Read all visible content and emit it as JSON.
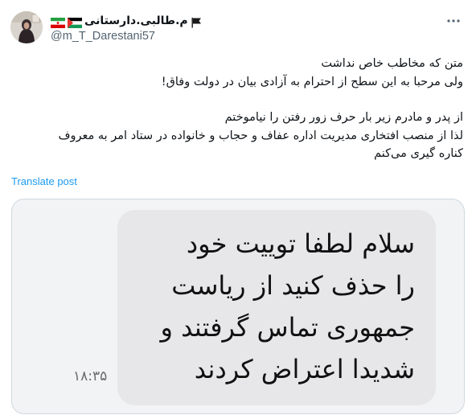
{
  "author": {
    "display_name": "م.طالبی.دارستانی",
    "handle": "@m_T_Darestani57",
    "avatar_icon": "profile-photo",
    "flags": [
      "iran-flag",
      "palestine-flag",
      "black-flag"
    ]
  },
  "header": {
    "more_icon": "more-horizontal-icon"
  },
  "tweet": {
    "lines": [
      "متن که مخاطب خاص نداشت",
      "ولی مرحبا به این سطح از احترام به آزادی بیان در دولت وفاق!",
      "",
      "از پدر و مادرم زیر بار حرف زور رفتن را نیاموختم",
      "لذا از منصب افتخاری مدیریت اداره عفاف و حجاب و خانواده در ستاد امر به معروف",
      "کناره گیری می‌کنم"
    ],
    "translate_label": "Translate post"
  },
  "media": {
    "message_lines": [
      "سلام لطفا توییت خود",
      "را حذف کنید از ریاست",
      "جمهوری تماس گرفتند و",
      "شدیدا اعتراض کردند"
    ],
    "time": "۱۸:۳۵"
  },
  "colors": {
    "link": "#1d9bf0",
    "secondary_text": "#536471",
    "bubble": "#e7e7e9",
    "media_bg": "#f2f3f5"
  }
}
